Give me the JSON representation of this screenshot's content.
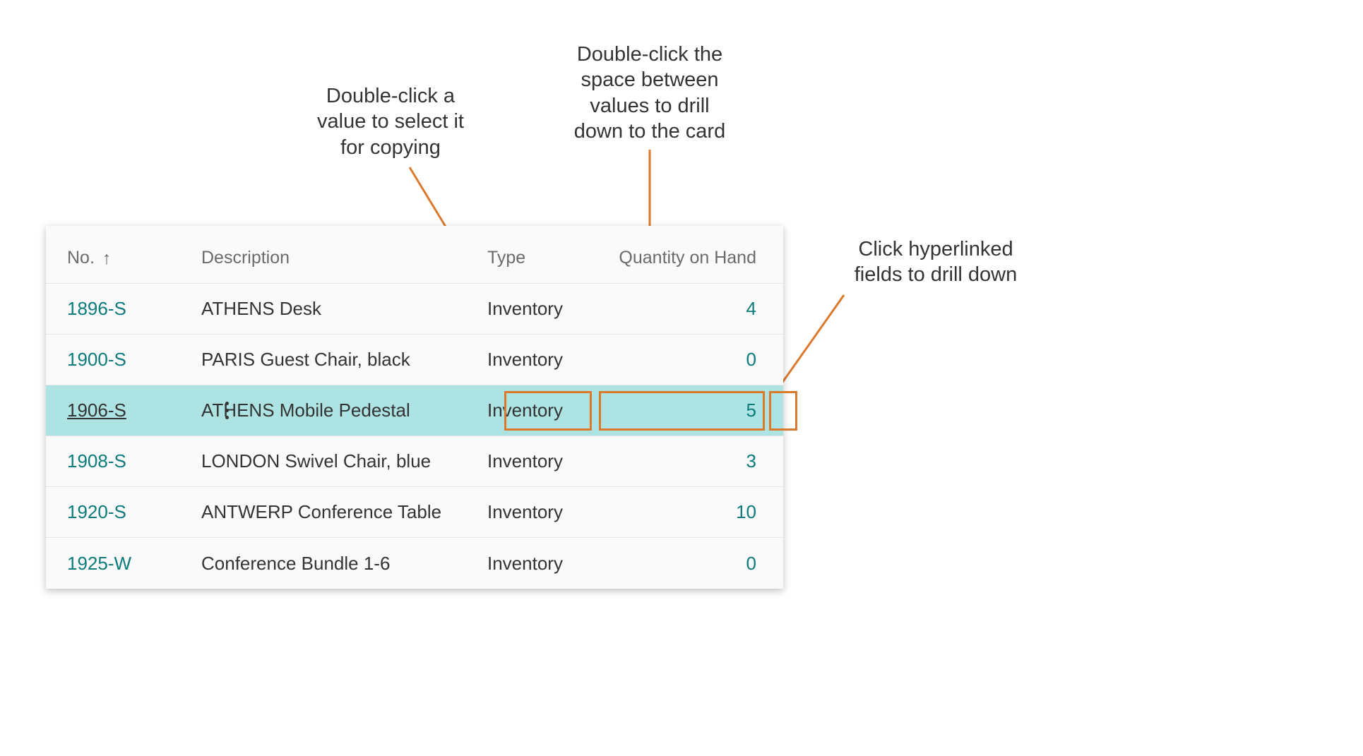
{
  "annotations": {
    "a1": "Double-click a\nvalue to select it\nfor copying",
    "a2": "Double-click the\nspace between\nvalues to drill\ndown to the card",
    "a3": "Click hyperlinked\nfields to drill down"
  },
  "table": {
    "headers": {
      "no": "No.",
      "desc": "Description",
      "type": "Type",
      "qty": "Quantity on Hand"
    },
    "rows": [
      {
        "no": "1896-S",
        "desc": "ATHENS Desk",
        "type": "Inventory",
        "qty": "4",
        "selected": false
      },
      {
        "no": "1900-S",
        "desc": "PARIS Guest Chair, black",
        "type": "Inventory",
        "qty": "0",
        "selected": false
      },
      {
        "no": "1906-S",
        "desc": "ATHENS Mobile Pedestal",
        "type": "Inventory",
        "qty": "5",
        "selected": true
      },
      {
        "no": "1908-S",
        "desc": "LONDON Swivel Chair, blue",
        "type": "Inventory",
        "qty": "3",
        "selected": false
      },
      {
        "no": "1920-S",
        "desc": "ANTWERP Conference Table",
        "type": "Inventory",
        "qty": "10",
        "selected": false
      },
      {
        "no": "1925-W",
        "desc": "Conference Bundle 1-6",
        "type": "Inventory",
        "qty": "0",
        "selected": false
      }
    ]
  }
}
